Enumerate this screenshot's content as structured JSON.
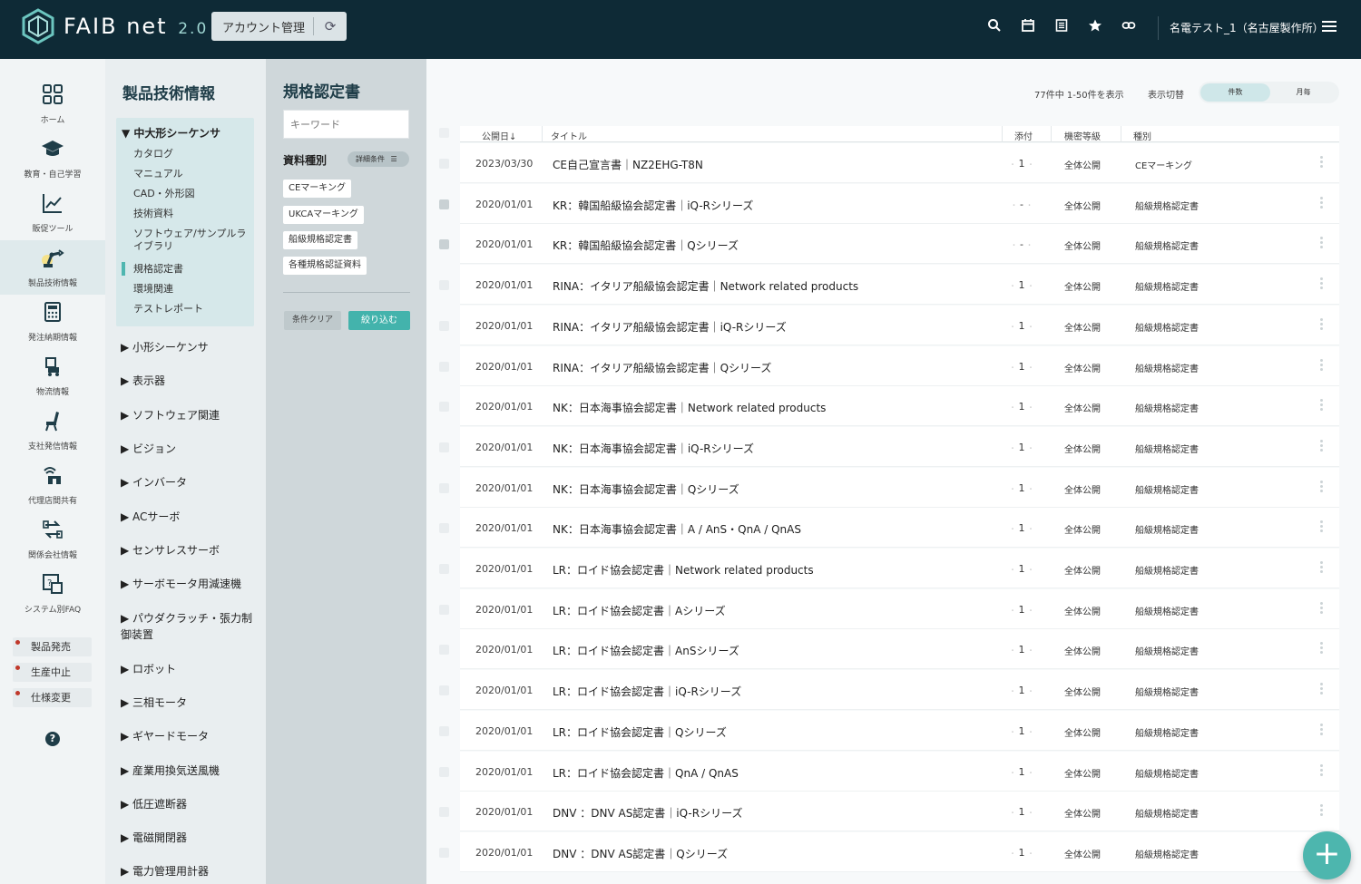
{
  "header": {
    "logo_text": "FAIB",
    "logo_net": "net",
    "logo_version": "2.0",
    "account_button_label": "アカウント管理",
    "user_label": "名電テスト_1（名古屋製作所）",
    "icons": [
      "search-icon",
      "calendar-icon",
      "document-icon",
      "star-icon",
      "link-icon",
      "hamburger-menu-icon"
    ]
  },
  "rail": {
    "items": [
      {
        "label": "ホーム",
        "icon": "grid-icon"
      },
      {
        "label": "教育・自己学習",
        "icon": "graduation-cap-icon"
      },
      {
        "label": "販促ツール",
        "icon": "chart-icon"
      },
      {
        "label": "製品技術情報",
        "icon": "robot-arm-icon",
        "active": true
      },
      {
        "label": "発注納期情報",
        "icon": "calculator-icon"
      },
      {
        "label": "物流情報",
        "icon": "forklift-icon"
      },
      {
        "label": "支社発信情報",
        "icon": "chair-icon"
      },
      {
        "label": "代理店間共有",
        "icon": "shop-signal-icon"
      },
      {
        "label": "関係会社情報",
        "icon": "exchange-icon"
      },
      {
        "label": "システム別FAQ",
        "icon": "faq-icon"
      }
    ],
    "tags": [
      "製品発売",
      "生産中止",
      "仕様変更"
    ],
    "help_label": "?"
  },
  "category": {
    "title": "製品技術情報",
    "open_group": "▼ 中大形シーケンサ",
    "sub_items": [
      "カタログ",
      "マニュアル",
      "CAD・外形図",
      "技術資料",
      "ソフトウェア/サンプルライブラリ",
      "規格認定書",
      "環境関連",
      "テストレポート"
    ],
    "groups": [
      "▶ 小形シーケンサ",
      "▶ 表示器",
      "▶ ソフトウェア関連",
      "▶ ビジョン",
      "▶ インバータ",
      "▶ ACサーボ",
      "▶ センサレスサーボ",
      "▶ サーボモータ用減速機",
      "▶ パウダクラッチ・張力制御装置",
      "▶ ロボット",
      "▶ 三相モータ",
      "▶ ギヤードモータ",
      "▶ 産業用換気送風機",
      "▶ 低圧遮断器",
      "▶ 電磁開閉器",
      "▶ 電力管理用計器"
    ]
  },
  "filter": {
    "title": "規格認定書",
    "keyword_placeholder": "キーワード",
    "type_label": "資料種別",
    "detail_button": "詳細条件",
    "chips": [
      "CEマーキング",
      "UKCAマーキング",
      "船級規格認定書",
      "各種規格認証資料"
    ],
    "clear_button": "条件クリア",
    "apply_button": "絞り込む"
  },
  "main": {
    "result_count": "77件中 1-50件を表示",
    "view_label": "表示切替",
    "view_options": [
      "件数",
      "月毎"
    ],
    "columns": [
      "公開日↓",
      "タイトル",
      "添付",
      "機密等級",
      "種別"
    ],
    "rows": [
      {
        "date": "2023/03/30",
        "title": "CE自己宣言書｜NZ2EHG-T8N",
        "att": "1",
        "conf": "全体公開",
        "kind": "CEマーキング",
        "check": "light"
      },
      {
        "date": "2020/01/01",
        "title": "KR：韓国船級協会認定書｜iQ-Rシリーズ",
        "att": "-",
        "conf": "全体公開",
        "kind": "船級規格認定書",
        "check": "dark"
      },
      {
        "date": "2020/01/01",
        "title": "KR：韓国船級協会認定書｜Qシリーズ",
        "att": "-",
        "conf": "全体公開",
        "kind": "船級規格認定書",
        "check": "dark"
      },
      {
        "date": "2020/01/01",
        "title": "RINA：イタリア船級協会認定書｜Network related products",
        "att": "1",
        "conf": "全体公開",
        "kind": "船級規格認定書",
        "check": "light"
      },
      {
        "date": "2020/01/01",
        "title": "RINA：イタリア船級協会認定書｜iQ-Rシリーズ",
        "att": "1",
        "conf": "全体公開",
        "kind": "船級規格認定書",
        "check": "light"
      },
      {
        "date": "2020/01/01",
        "title": "RINA：イタリア船級協会認定書｜Qシリーズ",
        "att": "1",
        "conf": "全体公開",
        "kind": "船級規格認定書",
        "check": "light"
      },
      {
        "date": "2020/01/01",
        "title": "NK：日本海事協会認定書｜Network related products",
        "att": "1",
        "conf": "全体公開",
        "kind": "船級規格認定書",
        "check": "light"
      },
      {
        "date": "2020/01/01",
        "title": "NK：日本海事協会認定書｜iQ-Rシリーズ",
        "att": "1",
        "conf": "全体公開",
        "kind": "船級規格認定書",
        "check": "light"
      },
      {
        "date": "2020/01/01",
        "title": "NK：日本海事協会認定書｜Qシリーズ",
        "att": "1",
        "conf": "全体公開",
        "kind": "船級規格認定書",
        "check": "light"
      },
      {
        "date": "2020/01/01",
        "title": "NK：日本海事協会認定書｜A / AnS・QnA / QnAS",
        "att": "1",
        "conf": "全体公開",
        "kind": "船級規格認定書",
        "check": "light"
      },
      {
        "date": "2020/01/01",
        "title": "LR：ロイド協会認定書｜Network related products",
        "att": "1",
        "conf": "全体公開",
        "kind": "船級規格認定書",
        "check": "light"
      },
      {
        "date": "2020/01/01",
        "title": "LR：ロイド協会認定書｜Aシリーズ",
        "att": "1",
        "conf": "全体公開",
        "kind": "船級規格認定書",
        "check": "light"
      },
      {
        "date": "2020/01/01",
        "title": "LR：ロイド協会認定書｜AnSシリーズ",
        "att": "1",
        "conf": "全体公開",
        "kind": "船級規格認定書",
        "check": "light"
      },
      {
        "date": "2020/01/01",
        "title": "LR：ロイド協会認定書｜iQ-Rシリーズ",
        "att": "1",
        "conf": "全体公開",
        "kind": "船級規格認定書",
        "check": "light"
      },
      {
        "date": "2020/01/01",
        "title": "LR：ロイド協会認定書｜Qシリーズ",
        "att": "1",
        "conf": "全体公開",
        "kind": "船級規格認定書",
        "check": "light"
      },
      {
        "date": "2020/01/01",
        "title": "LR：ロイド協会認定書｜QnA / QnAS",
        "att": "1",
        "conf": "全体公開",
        "kind": "船級規格認定書",
        "check": "light"
      },
      {
        "date": "2020/01/01",
        "title": "DNV ：DNV AS認定書｜iQ-Rシリーズ",
        "att": "1",
        "conf": "全体公開",
        "kind": "船級規格認定書",
        "check": "light"
      },
      {
        "date": "2020/01/01",
        "title": "DNV ：DNV AS認定書｜Qシリーズ",
        "att": "1",
        "conf": "全体公開",
        "kind": "船級規格認定書",
        "check": "light"
      }
    ]
  },
  "fab_label": "+",
  "colors": {
    "header_bg": "#0e2a36",
    "accent": "#43b3ac",
    "filter_bg": "#cfd7da"
  }
}
